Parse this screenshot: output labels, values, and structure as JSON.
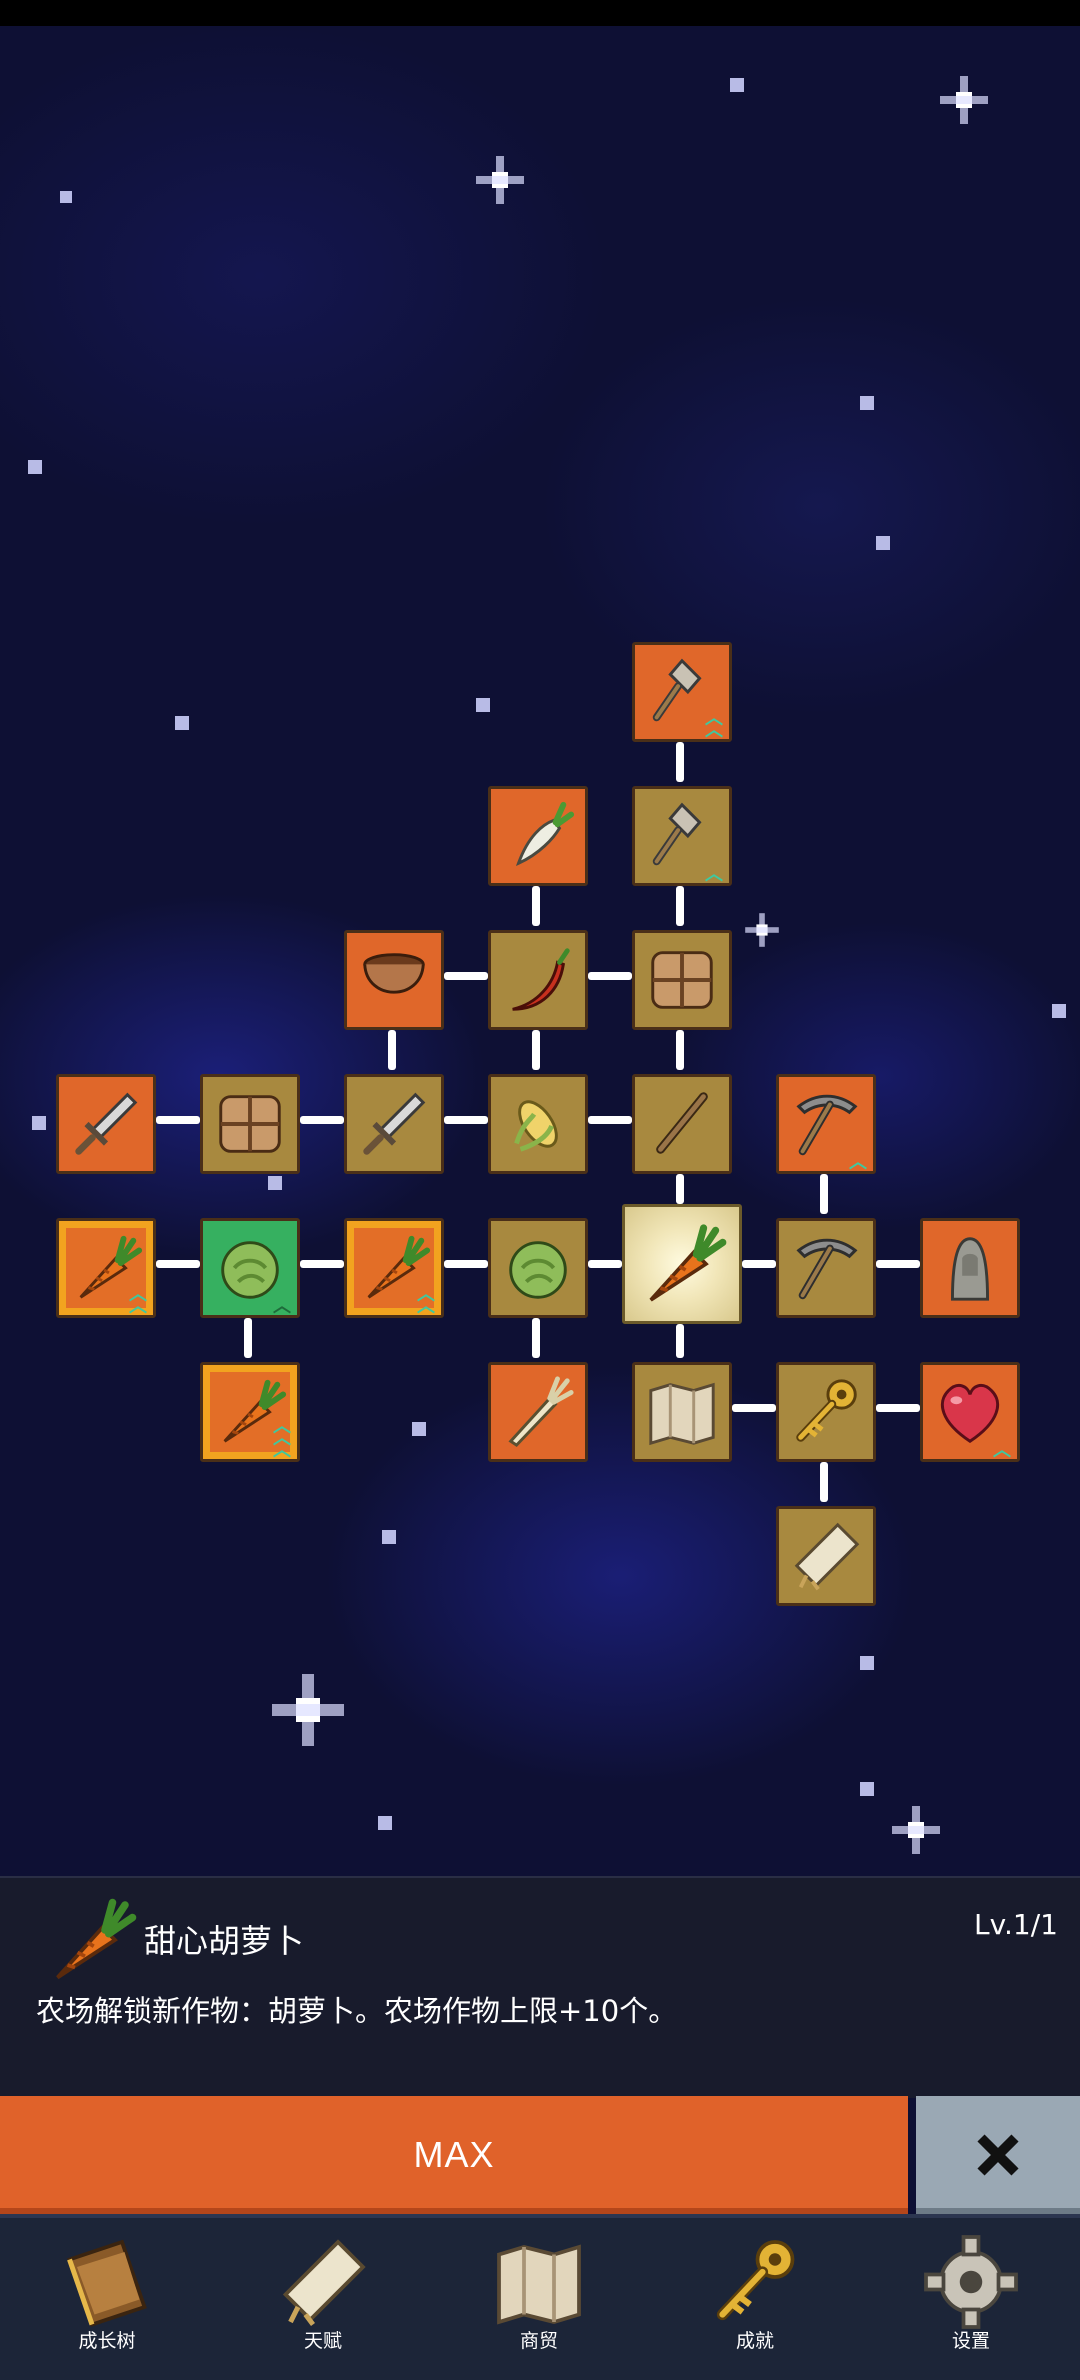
{
  "skill_tree": {
    "nodes": [
      {
        "id": "shovel-top",
        "icon": "shovel-icon",
        "bg": "orange"
      },
      {
        "id": "radish",
        "icon": "radish-icon",
        "bg": "orange"
      },
      {
        "id": "shovel-mid",
        "icon": "shovel-icon",
        "bg": "gold"
      },
      {
        "id": "clay-pot",
        "icon": "pot-icon",
        "bg": "orange"
      },
      {
        "id": "chili",
        "icon": "chili-icon",
        "bg": "gold"
      },
      {
        "id": "crate-top",
        "icon": "crate-icon",
        "bg": "gold"
      },
      {
        "id": "sword-left",
        "icon": "sword-icon",
        "bg": "orange"
      },
      {
        "id": "crate-left",
        "icon": "crate-icon",
        "bg": "gold"
      },
      {
        "id": "sword-mid",
        "icon": "sword-icon",
        "bg": "gold"
      },
      {
        "id": "corn",
        "icon": "corn-icon",
        "bg": "gold"
      },
      {
        "id": "stick",
        "icon": "stick-icon",
        "bg": "gold"
      },
      {
        "id": "pickaxe-top",
        "icon": "pickaxe-icon",
        "bg": "orange"
      },
      {
        "id": "carrot-left",
        "icon": "carrot-icon",
        "bg": "carrot-frame"
      },
      {
        "id": "cabbage-green",
        "icon": "cabbage-icon",
        "bg": "green"
      },
      {
        "id": "carrot-mid",
        "icon": "carrot-icon",
        "bg": "carrot-frame"
      },
      {
        "id": "cabbage-gold",
        "icon": "cabbage-icon",
        "bg": "gold"
      },
      {
        "id": "sweet-carrot",
        "icon": "carrot-icon",
        "bg": "selected"
      },
      {
        "id": "pickaxe-mid",
        "icon": "pickaxe-icon",
        "bg": "gold"
      },
      {
        "id": "statue",
        "icon": "statue-icon",
        "bg": "orange"
      },
      {
        "id": "carrot-bottom",
        "icon": "carrot-icon",
        "bg": "carrot-frame"
      },
      {
        "id": "leek",
        "icon": "leek-icon",
        "bg": "orange"
      },
      {
        "id": "map",
        "icon": "map-icon",
        "bg": "gold"
      },
      {
        "id": "key",
        "icon": "key-icon",
        "bg": "gold"
      },
      {
        "id": "heart",
        "icon": "heart-icon",
        "bg": "orange"
      },
      {
        "id": "scroll",
        "icon": "scroll-icon",
        "bg": "gold"
      }
    ]
  },
  "info_panel": {
    "icon": "carrot-icon",
    "title": "甜心胡萝卜",
    "level": "Lv.1/1",
    "description": "农场解锁新作物：胡萝卜。农场作物上限+10个。"
  },
  "actions": {
    "max_label": "MAX",
    "close_icon": "close-icon"
  },
  "nav": {
    "items": [
      {
        "label": "成长树",
        "icon": "book-icon"
      },
      {
        "label": "天赋",
        "icon": "scroll-icon"
      },
      {
        "label": "商贸",
        "icon": "map-icon"
      },
      {
        "label": "成就",
        "icon": "key-icon"
      },
      {
        "label": "设置",
        "icon": "gear-icon"
      }
    ]
  },
  "colors": {
    "accent_orange": "#e0622a",
    "node_gold": "#a8893f",
    "node_green": "#36b060",
    "panel_bg": "#181b2c",
    "nav_bg": "#1c2538"
  }
}
